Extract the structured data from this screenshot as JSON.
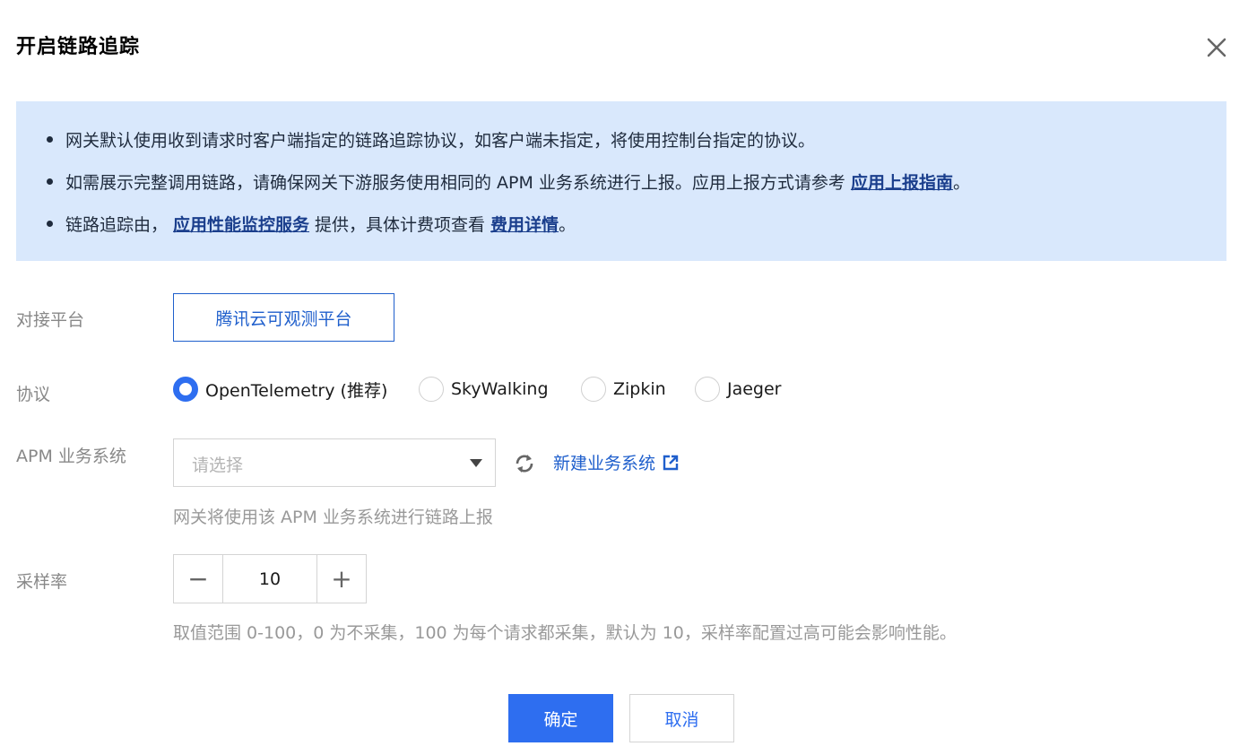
{
  "dialog": {
    "title": "开启链路追踪",
    "close_icon": "close-icon"
  },
  "notice": {
    "line1": "网关默认使用收到请求时客户端指定的链路追踪协议，如客户端未指定，将使用控制台指定的协议。",
    "line2_prefix": "如需展示完整调用链路，请确保网关下游服务使用相同的 APM 业务系统进行上报。应用上报方式请参考",
    "line2_link": "应用上报指南",
    "line2_suffix": "。",
    "line3_prefix": "链路追踪由，",
    "line3_link1": "应用性能监控服务",
    "line3_middle": "提供，具体计费项查看",
    "line3_link2": "费用详情",
    "line3_suffix": "。"
  },
  "platform": {
    "label": "对接平台",
    "value": "腾讯云可观测平台"
  },
  "protocol": {
    "label": "协议",
    "options": [
      "OpenTelemetry (推荐)",
      "SkyWalking",
      "Zipkin",
      "Jaeger"
    ],
    "selected": "OpenTelemetry (推荐)"
  },
  "apm": {
    "label": "APM 业务系统",
    "placeholder": "请选择",
    "new_link": "新建业务系统",
    "hint": "网关将使用该 APM 业务系统进行链路上报"
  },
  "sampling": {
    "label": "采样率",
    "value": "10",
    "minus": "−",
    "plus": "+",
    "hint": "取值范围 0-100，0 为不采集，100 为每个请求都采集，默认为 10，采样率配置过高可能会影响性能。"
  },
  "footer": {
    "ok": "确定",
    "cancel": "取消"
  },
  "colors": {
    "primary": "#2e6ef0",
    "notice_bg": "#d9e8fc",
    "link": "#1a3e8c"
  }
}
